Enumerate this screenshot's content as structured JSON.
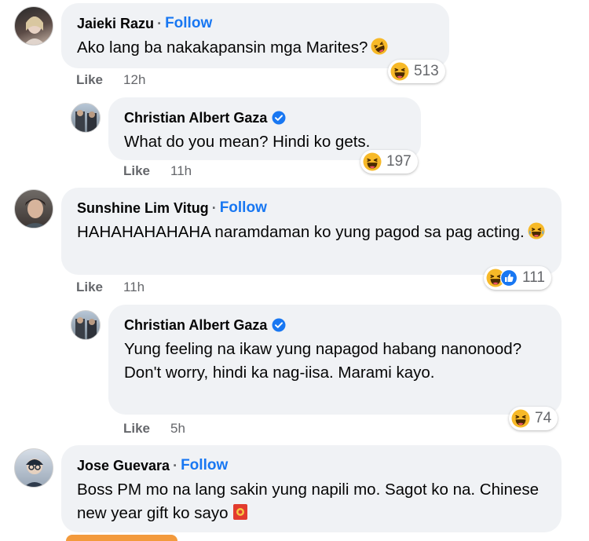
{
  "comments": [
    {
      "name": "Jaieki Razu",
      "follow": "Follow",
      "text": "Ako lang ba nakakapansin mga Marites?",
      "like": "Like",
      "time": "12h",
      "reaction_count": "513",
      "avatar_icon": "profile-photo-icon",
      "text_emoji": "rolling-laughing-emoji"
    },
    {
      "name": "Christian Albert Gaza",
      "text": "What do you mean? Hindi ko gets.",
      "like": "Like",
      "time": "11h",
      "reaction_count": "197",
      "verified": true
    },
    {
      "name": "Sunshine Lim Vitug",
      "follow": "Follow",
      "text": "HAHAHAHAHAHA naramdaman ko yung pagod sa pag acting.",
      "like": "Like",
      "time": "11h",
      "reaction_count": "111",
      "text_emoji": "tears-of-joy-emoji"
    },
    {
      "name": "Christian Albert Gaza",
      "text": "Yung feeling na ikaw yung napagod habang nanonood? Don't worry, hindi ka nag-iisa. Marami kayo.",
      "like": "Like",
      "time": "5h",
      "reaction_count": "74",
      "verified": true
    },
    {
      "name": "Jose Guevara",
      "follow": "Follow",
      "text": "Boss PM mo na lang sakin yung napili mo. Sagot ko na. Chinese new year gift ko sayo",
      "text_emoji": "red-envelope-emoji"
    }
  ],
  "colors": {
    "bubble": "#f0f2f5",
    "follow": "#1877f2",
    "meta": "#65676b",
    "haha": "#f7b125",
    "like_reaction": "#1877f2"
  }
}
